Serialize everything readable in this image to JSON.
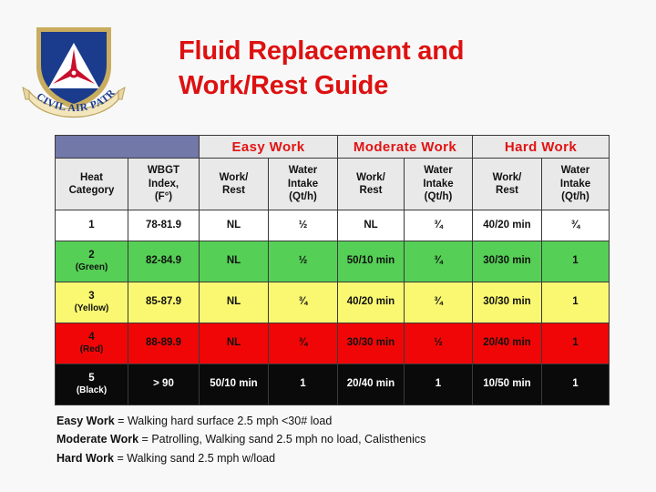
{
  "logo": {
    "name": "civil-air-patrol-seal",
    "banner_text": "CIVIL AIR PATROL",
    "shield_color": "#1b3c8c",
    "triangle_color": "#ffffff",
    "propeller_color": "#c8102e",
    "banner_color": "#f2e3b0"
  },
  "title": {
    "line1": "Fluid Replacement and",
    "line2": "Work/Rest Guide",
    "color": "#dd1111"
  },
  "table": {
    "group_headers": [
      {
        "label": "",
        "span": 2,
        "style": "purple"
      },
      {
        "label": "Easy Work",
        "span": 2,
        "style": "red-text"
      },
      {
        "label": "Moderate Work",
        "span": 2,
        "style": "red-text"
      },
      {
        "label": "Hard Work",
        "span": 2,
        "style": "red-text"
      }
    ],
    "column_headers": [
      "Heat Category",
      "WBGT Index, (F°)",
      "Work/ Rest",
      "Water Intake (Qt/h)",
      "Work/ Rest",
      "Water Intake (Qt/h)",
      "Work/ Rest",
      "Water Intake (Qt/h)"
    ],
    "column_headers_parts": [
      [
        "Heat",
        "Category"
      ],
      [
        "WBGT",
        "Index,",
        "(F°)"
      ],
      [
        "Work/",
        "Rest"
      ],
      [
        "Water",
        "Intake",
        "(Qt/h)"
      ],
      [
        "Work/",
        "Rest"
      ],
      [
        "Water",
        "Intake",
        "(Qt/h)"
      ],
      [
        "Work/",
        "Rest"
      ],
      [
        "Water",
        "Intake",
        "(Qt/h)"
      ]
    ],
    "rows": [
      {
        "category": "1",
        "category_note": "",
        "wbgt": "78-81.9",
        "easy_work_rest": "NL",
        "easy_water": "½",
        "moderate_work_rest": "NL",
        "moderate_water": "¾",
        "hard_work_rest": "40/20 min",
        "hard_water": "¾",
        "row_color": "#ffffff",
        "color_name": "white"
      },
      {
        "category": "2",
        "category_note": "(Green)",
        "wbgt": "82-84.9",
        "easy_work_rest": "NL",
        "easy_water": "½",
        "moderate_work_rest": "50/10 min",
        "moderate_water": "¾",
        "hard_work_rest": "30/30 min",
        "hard_water": "1",
        "row_color": "#55cf55",
        "color_name": "green"
      },
      {
        "category": "3",
        "category_note": "(Yellow)",
        "wbgt": "85-87.9",
        "easy_work_rest": "NL",
        "easy_water": "¾",
        "moderate_work_rest": "40/20 min",
        "moderate_water": "¾",
        "hard_work_rest": "30/30 min",
        "hard_water": "1",
        "row_color": "#faf871",
        "color_name": "yellow"
      },
      {
        "category": "4",
        "category_note": "(Red)",
        "wbgt": "88-89.9",
        "easy_work_rest": "NL",
        "easy_water": "¾",
        "moderate_work_rest": "30/30 min",
        "moderate_water": "½",
        "hard_work_rest": "20/40 min",
        "hard_water": "1",
        "row_color": "#f00606",
        "color_name": "red"
      },
      {
        "category": "5",
        "category_note": "(Black)",
        "wbgt": "> 90",
        "easy_work_rest": "50/10 min",
        "easy_water": "1",
        "moderate_work_rest": "20/40 min",
        "moderate_water": "1",
        "hard_work_rest": "10/50 min",
        "hard_water": "1",
        "row_color": "#0a0a0a",
        "color_name": "black"
      }
    ]
  },
  "legend": [
    {
      "term": "Easy Work",
      "desc": " = Walking hard surface 2.5 mph <30# load"
    },
    {
      "term": "Moderate Work",
      "desc": " = Patrolling, Walking sand 2.5 mph no load, Calisthenics"
    },
    {
      "term": "Hard Work",
      "desc": " = Walking sand 2.5 mph w/load"
    }
  ]
}
